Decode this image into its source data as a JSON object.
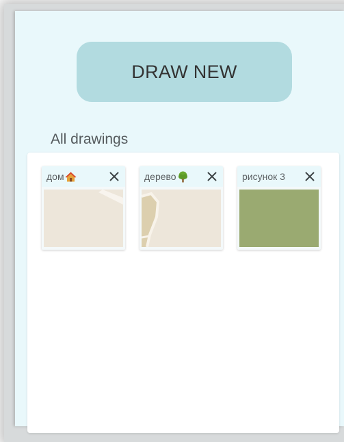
{
  "draw_new_label": "DRAW NEW",
  "section_title": "All drawings",
  "drawings": [
    {
      "title": "дом",
      "emoji_icon": "house-emoji-icon"
    },
    {
      "title": "дерево",
      "emoji_icon": "tree-emoji-icon"
    },
    {
      "title": "рисунок 3",
      "emoji_icon": ""
    }
  ],
  "colors": {
    "background": "#e9f8fb",
    "button": "#b2dbe0",
    "map_beige": "#ede6da",
    "thumb_green": "#9aaa71"
  }
}
